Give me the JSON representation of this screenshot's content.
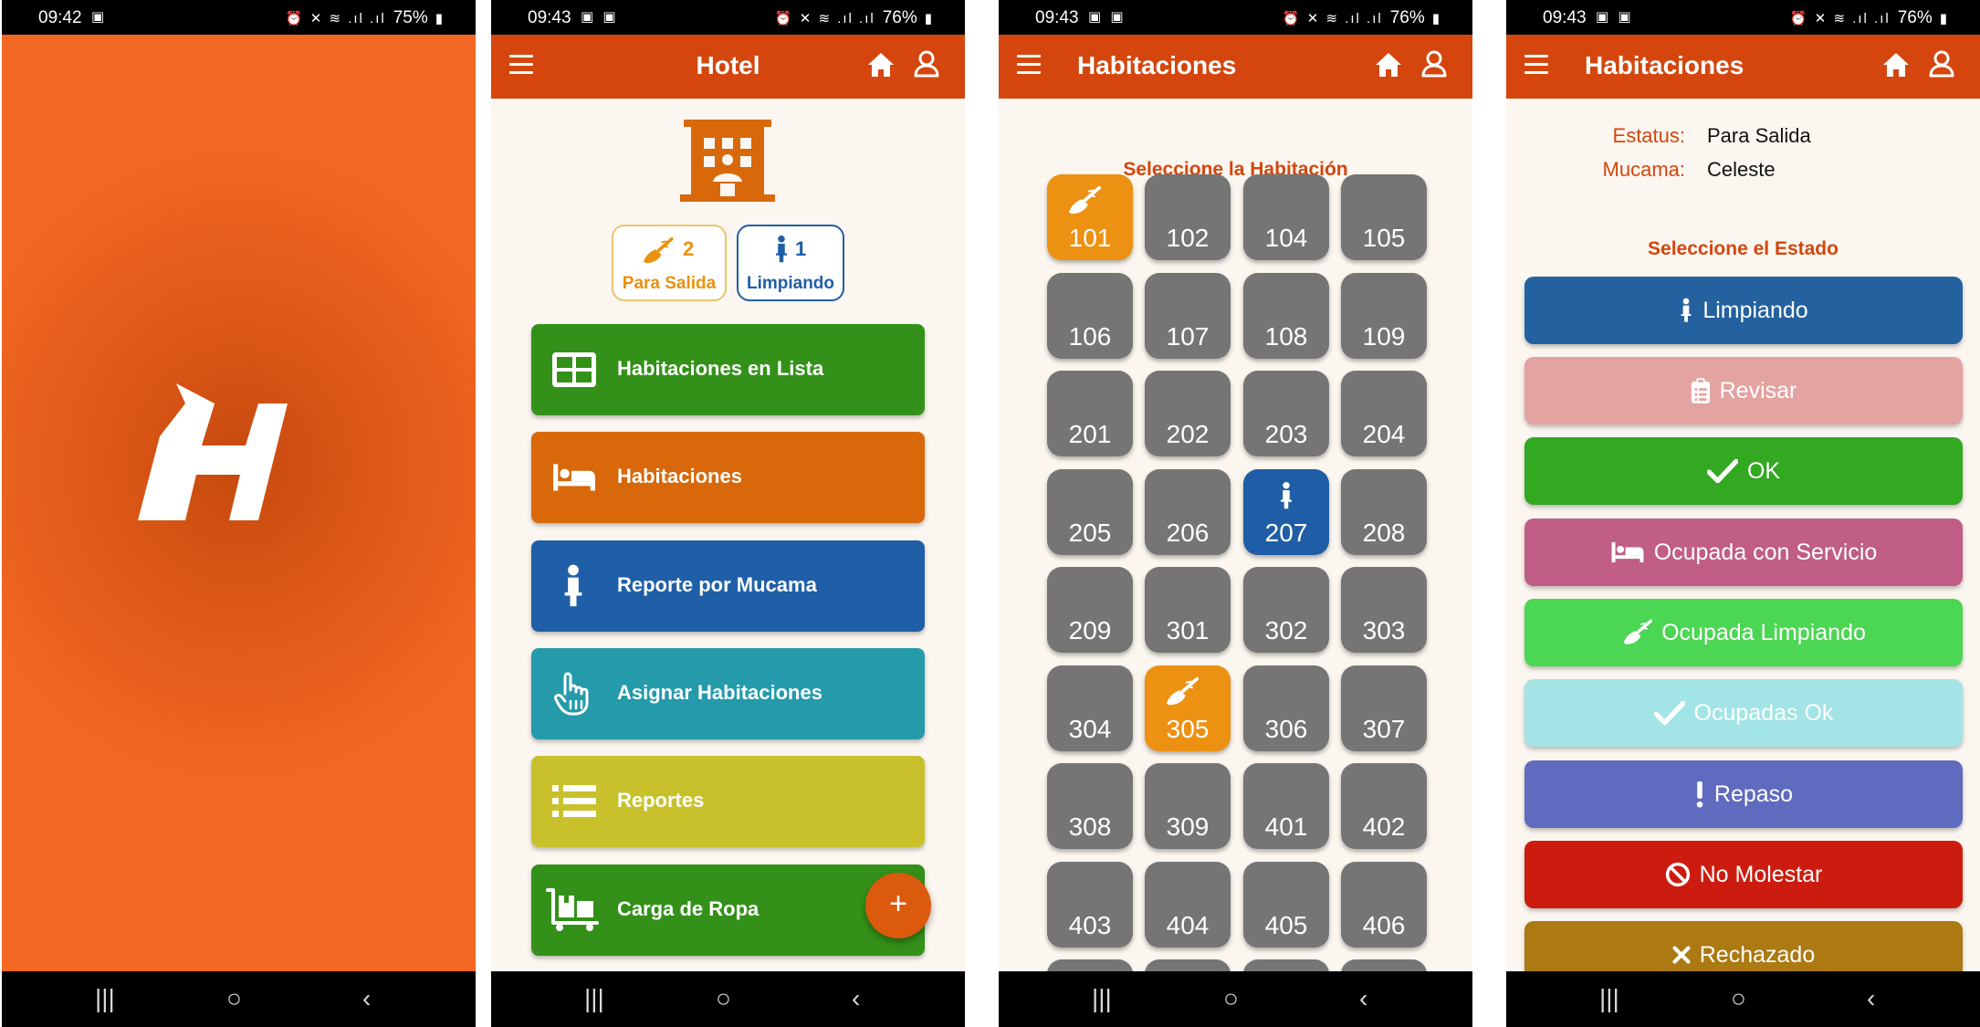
{
  "phones": [
    {
      "status": {
        "time": "09:42",
        "battery": "75%"
      }
    },
    {
      "status": {
        "time": "09:43",
        "battery": "76%"
      }
    },
    {
      "status": {
        "time": "09:43",
        "battery": "76%"
      }
    },
    {
      "status": {
        "time": "09:43",
        "battery": "76%"
      }
    }
  ],
  "splash": {
    "logo": "hotel-h-logo"
  },
  "home": {
    "title": "Hotel",
    "badges": [
      {
        "count": "2",
        "label": "Para Salida",
        "icon": "broom-icon",
        "color": "#e8920e"
      },
      {
        "count": "1",
        "label": "Limpiando",
        "icon": "maid-icon",
        "color": "#1f5ea6"
      }
    ],
    "menu": [
      {
        "label": "Habitaciones en Lista",
        "icon": "grid-list-icon",
        "color": "#339119"
      },
      {
        "label": "Habitaciones",
        "icon": "bed-icon",
        "color": "#d8680a"
      },
      {
        "label": "Reporte por Mucama",
        "icon": "maid-icon",
        "color": "#1f5fa7"
      },
      {
        "label": "Asignar Habitaciones",
        "icon": "hand-pointer-icon",
        "color": "#249aab"
      },
      {
        "label": "Reportes",
        "icon": "list-icon",
        "color": "#c8c12c"
      },
      {
        "label": "Carga de Ropa",
        "icon": "laundry-cart-icon",
        "color": "#339119"
      }
    ],
    "fab_label": "+"
  },
  "rooms": {
    "title": "Habitaciones",
    "prompt": "Seleccione la Habitación",
    "items": [
      {
        "number": "101",
        "state": "para-salida"
      },
      {
        "number": "102",
        "state": "none"
      },
      {
        "number": "104",
        "state": "none"
      },
      {
        "number": "105",
        "state": "none"
      },
      {
        "number": "106",
        "state": "none"
      },
      {
        "number": "107",
        "state": "none"
      },
      {
        "number": "108",
        "state": "none"
      },
      {
        "number": "109",
        "state": "none"
      },
      {
        "number": "201",
        "state": "none"
      },
      {
        "number": "202",
        "state": "none"
      },
      {
        "number": "203",
        "state": "none"
      },
      {
        "number": "204",
        "state": "none"
      },
      {
        "number": "205",
        "state": "none"
      },
      {
        "number": "206",
        "state": "none"
      },
      {
        "number": "207",
        "state": "limpiando"
      },
      {
        "number": "208",
        "state": "none"
      },
      {
        "number": "209",
        "state": "none"
      },
      {
        "number": "301",
        "state": "none"
      },
      {
        "number": "302",
        "state": "none"
      },
      {
        "number": "303",
        "state": "none"
      },
      {
        "number": "304",
        "state": "none"
      },
      {
        "number": "305",
        "state": "para-salida"
      },
      {
        "number": "306",
        "state": "none"
      },
      {
        "number": "307",
        "state": "none"
      },
      {
        "number": "308",
        "state": "none"
      },
      {
        "number": "309",
        "state": "none"
      },
      {
        "number": "401",
        "state": "none"
      },
      {
        "number": "402",
        "state": "none"
      },
      {
        "number": "403",
        "state": "none"
      },
      {
        "number": "404",
        "state": "none"
      },
      {
        "number": "405",
        "state": "none"
      },
      {
        "number": "406",
        "state": "none"
      }
    ],
    "colors": {
      "none": "#757575",
      "para-salida": "#ec9112",
      "limpiando": "#1f5ea6"
    }
  },
  "room_status": {
    "title": "Habitaciones",
    "estatus_label": "Estatus:",
    "estatus_value": "Para Salida",
    "mucama_label": "Mucama:",
    "mucama_value": "Celeste",
    "prompt": "Seleccione el Estado",
    "states": [
      {
        "label": "Limpiando",
        "icon": "maid-icon",
        "color": "#23619f"
      },
      {
        "label": "Revisar",
        "icon": "clipboard-icon",
        "color": "#e3a3a0"
      },
      {
        "label": "OK",
        "icon": "check-icon",
        "color": "#33a821"
      },
      {
        "label": "Ocupada con Servicio",
        "icon": "bed-icon",
        "color": "#c05e85"
      },
      {
        "label": "Ocupada Limpiando",
        "icon": "broom-icon",
        "color": "#4bd653"
      },
      {
        "label": "Ocupadas Ok",
        "icon": "check-icon",
        "color": "#a3e4e6"
      },
      {
        "label": "Repaso",
        "icon": "exclamation-icon",
        "color": "#5f6bbf"
      },
      {
        "label": "No Molestar",
        "icon": "ban-icon",
        "color": "#cc1c0f"
      },
      {
        "label": "Rechazado",
        "icon": "x-icon",
        "color": "#ac7912"
      }
    ]
  }
}
